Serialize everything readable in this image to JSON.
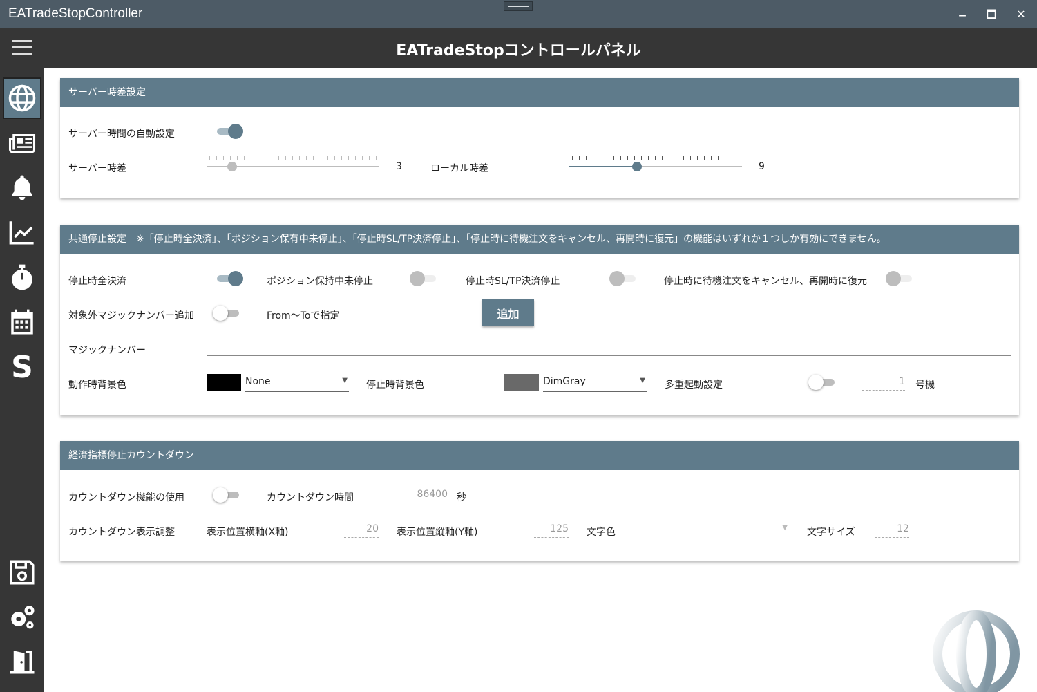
{
  "window": {
    "title": "EATradeStopController",
    "minimize": "🗕",
    "maximize": "🗖",
    "close": "✕"
  },
  "header": {
    "title": "EATradeStopコントロールパネル",
    "menu_icon": "hamburger-icon"
  },
  "sidebar": {
    "items": [
      {
        "icon": "globe-icon",
        "active": true
      },
      {
        "icon": "newspaper-icon"
      },
      {
        "icon": "bell-icon"
      },
      {
        "icon": "chart-line-icon"
      },
      {
        "icon": "stopwatch-icon"
      },
      {
        "icon": "calendar-icon"
      },
      {
        "icon": "s-letter-icon",
        "glyph": "S"
      },
      {
        "icon": "save-icon"
      },
      {
        "icon": "gears-icon"
      },
      {
        "icon": "exit-door-icon"
      }
    ]
  },
  "server_card": {
    "title": "サーバー時差設定",
    "auto_label": "サーバー時間の自動設定",
    "auto_on": true,
    "server_offset_label": "サーバー時差",
    "server_offset_value": "3",
    "local_offset_label": "ローカル時差",
    "local_offset_value": "9"
  },
  "stop_card": {
    "title": "共通停止設定",
    "note": "※「停止時全決済」、「ポジション保有中未停止」、「停止時SL/TP決済停止」、「停止時に待機注文をキャンセル、再開時に復元」の機能はいずれか１つしか有効にできません。",
    "close_all_label": "停止時全決済",
    "keep_position_label": "ポジション保持中未停止",
    "sltp_label": "停止時SL/TP決済停止",
    "pending_label": "停止時に待機注文をキャンセル、再開時に復元",
    "exclude_magic_label": "対象外マジックナンバー追加",
    "from_to_label": "From～Toで指定",
    "add_button": "追加",
    "magic_label": "マジックナンバー",
    "run_bg_label": "動作時背景色",
    "run_bg_value": "None",
    "run_bg_color": "#000000",
    "stop_bg_label": "停止時背景色",
    "stop_bg_value": "DimGray",
    "stop_bg_color": "#696969",
    "multi_label": "多重起動設定",
    "multi_value": "1",
    "multi_unit": "号機"
  },
  "countdown_card": {
    "title": "経済指標停止カウントダウン",
    "use_label": "カウントダウン機能の使用",
    "time_label": "カウントダウン時間",
    "time_value": "86400",
    "time_unit": "秒",
    "display_label": "カウントダウン表示調整",
    "x_label": "表示位置横軸(X軸)",
    "x_value": "20",
    "y_label": "表示位置縦軸(Y軸)",
    "y_value": "125",
    "color_label": "文字色",
    "size_label": "文字サイズ",
    "size_value": "12"
  },
  "colors": {
    "accent": "#5f7b8b",
    "chrome": "#363636",
    "titlebar": "#4d5b66"
  }
}
